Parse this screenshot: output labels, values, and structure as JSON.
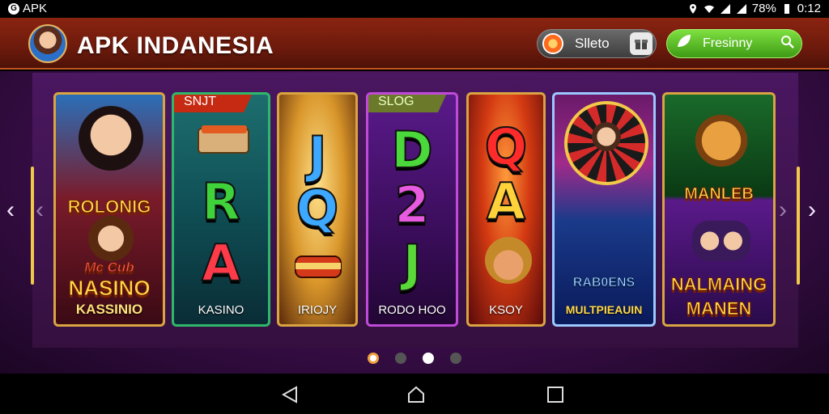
{
  "status_bar": {
    "app": "APK",
    "battery": "78%",
    "time": "0:12"
  },
  "header": {
    "brand": "APK INDANESIA",
    "pill_1": {
      "label": "Slleto",
      "left_icon": "orange-coin-icon",
      "right_icon": "gift-icon"
    },
    "pill_2": {
      "label": "Fresinny",
      "left_icon": "leaf-icon",
      "right_icon": "search-icon"
    }
  },
  "cards": [
    {
      "title_top": "ROLONIG",
      "title_mid": "Mc Cub",
      "title_main": "NASINO",
      "caption": "KASSINIO"
    },
    {
      "ribbon": "SNJT",
      "letters": [
        "R",
        "A"
      ],
      "caption": "KASINO"
    },
    {
      "letters": [
        "J",
        "Q"
      ],
      "caption": "IRIOJY"
    },
    {
      "ribbon": "SLOG",
      "letters": [
        "D",
        "2",
        "J"
      ],
      "caption": "RODO HOO"
    },
    {
      "letters": [
        "Q",
        "A"
      ],
      "caption": "KSOY"
    },
    {
      "top_scene": "wheel",
      "badge": "RAB0ENS",
      "caption": "MULTPIEAUIN"
    },
    {
      "top_title": "MANLEB",
      "bottom_title_1": "NALMAING",
      "bottom_title_2": "MANEN"
    }
  ],
  "carousel": {
    "page_count": 4,
    "active_index": 2
  },
  "colors": {
    "header": "#7a1d0d",
    "accent_gold": "#d9a441",
    "green_button": "#4fb21c",
    "stage": "#3a0e4a"
  }
}
